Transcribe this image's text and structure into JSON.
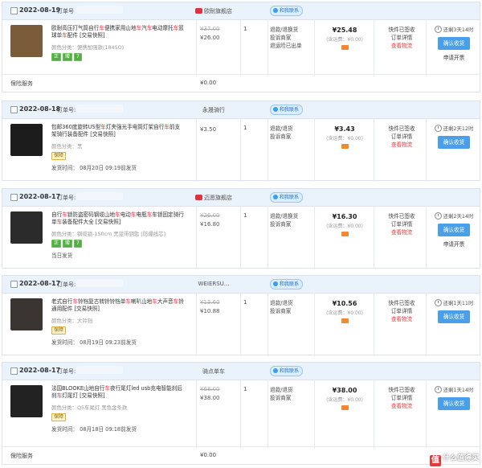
{
  "labels": {
    "order_no": "订单号",
    "order_no_colon": "订单号:",
    "chat": "和我联系",
    "confirm": "确认收货",
    "apply_refund": "申请开票",
    "insurance": "保险服务"
  },
  "orders": [
    {
      "date": "2022-08-19",
      "shop": "欧耐旗舰店",
      "title_parts": [
        "欧耐高压打气筒自行",
        [
          "车"
        ],
        "便携家用山地",
        [
          "车"
        ],
        "汽",
        [
          "车"
        ],
        "电动摩托",
        [
          "车"
        ],
        "篮球单",
        [
          "车"
        ],
        "配件 [交易快照]"
      ],
      "attr": "颜色分类：便携加强款(184SO)",
      "tags": [
        "正",
        "赠",
        "7"
      ],
      "orig": "¥37.00",
      "price": "¥26.00",
      "qty": "1",
      "after": [
        "退款/退换货",
        "投诉商家",
        "退运险已出单"
      ],
      "total": "¥25.48",
      "ship": "(含运费：¥0.00)",
      "status": [
        "快件已签收",
        "订单详情",
        "查看物流"
      ],
      "remain": "还剩3天14时",
      "has_apply": true,
      "foot_label": "保险服务",
      "foot_val": "¥0.00"
    },
    {
      "date": "2022-08-18",
      "shop": "永晟骑行",
      "title_parts": [
        "包邮360度旋转US型",
        [
          "车"
        ],
        "灯夹强光手电筒灯架自行",
        [
          "车"
        ],
        "前支架骑行装备配件 [交易快照]"
      ],
      "attr": "颜色分类：黑",
      "tags": [
        "保障"
      ],
      "orig": "",
      "price": "¥3.50",
      "qty": "1",
      "after": [
        "退款/退货",
        "投诉商家"
      ],
      "total": "¥3.43",
      "ship": "(含运费：¥0.00)",
      "status": [
        "快件已签收",
        "订单详情",
        "查看物流"
      ],
      "remain": "还剩2天12时",
      "has_apply": false,
      "ship_note": "发货时间：  08月20日 09:19前发货"
    },
    {
      "date": "2022-08-17",
      "shop": "迈愿旗舰店",
      "title_parts": [
        "自行",
        [
          "车"
        ],
        "锁防盗密码钢缆山地",
        [
          "车"
        ],
        "电动",
        [
          "车"
        ],
        "电瓶",
        [
          "车"
        ],
        "车锁固定骑行单",
        [
          "车"
        ],
        "装备配件大全 [交易快照]"
      ],
      "attr": "颜色分类：钢缆锁-150cm 黑蓝带钥匙 [防爆线芯]",
      "tags": [
        "正",
        "赠",
        "7"
      ],
      "orig": "¥26.00",
      "price": "¥16.80",
      "qty": "1",
      "after": [
        "退款/退换货",
        "投诉商家"
      ],
      "total": "¥16.30",
      "ship": "(含运费：¥0.00)",
      "status": [
        "快件已签收",
        "订单详情",
        "查看物流"
      ],
      "remain": "还剩2天14时",
      "has_apply": true,
      "ship_note": "当日发货"
    },
    {
      "date": "2022-08-17",
      "shop": "WEIERSU...",
      "title_parts": [
        "老式自行",
        [
          "车"
        ],
        "铃铛复古转铃铃铛单",
        [
          "车"
        ],
        "喇叭山地",
        [
          "车"
        ],
        "大声音",
        [
          "车"
        ],
        "铃通用配件 [交易快照]"
      ],
      "attr": "颜色分类：大铃铛",
      "tags": [
        "保障"
      ],
      "orig": "¥13.60",
      "price": "¥10.88",
      "qty": "1",
      "after": [
        "退款/退货",
        "投诉商家"
      ],
      "total": "¥10.56",
      "ship": "(含运费：¥0.00)",
      "status": [
        "快件已签收",
        "订单详情",
        "查看物流"
      ],
      "remain": "还剩1天11时",
      "has_apply": false,
      "ship_note": "发货时间：  08月19日 09:23前发货"
    },
    {
      "date": "2022-08-17",
      "shop": "骑点单车",
      "title_parts": [
        "法国BLOOKE山地自行",
        [
          "车"
        ],
        "夜行尾灯led usb充电智能刹后刹",
        [
          "车"
        ],
        "灯尾灯 [交易快照]"
      ],
      "attr": "颜色分类：Q5车尾灯 黑色金条款",
      "tags": [
        "保障"
      ],
      "orig": "¥68.00",
      "price": "¥38.00",
      "qty": "1",
      "after": [
        "退款/退货",
        "投诉商家"
      ],
      "total": "¥38.00",
      "ship": "(含运费：¥0.00)",
      "status": [
        "快件已签收",
        "订单详情",
        "查看物流"
      ],
      "remain": "还剩1天14时",
      "has_apply": false,
      "ship_note": "发货时间：  08月18日 09:18前发货",
      "foot_label": "保险服务",
      "foot_val": "¥0.00"
    }
  ],
  "watermark": "值 什么值得买",
  "colors": {
    "accent": "#4a9fe8",
    "header": "#eaf2fb",
    "highlight": "#e4393c"
  }
}
